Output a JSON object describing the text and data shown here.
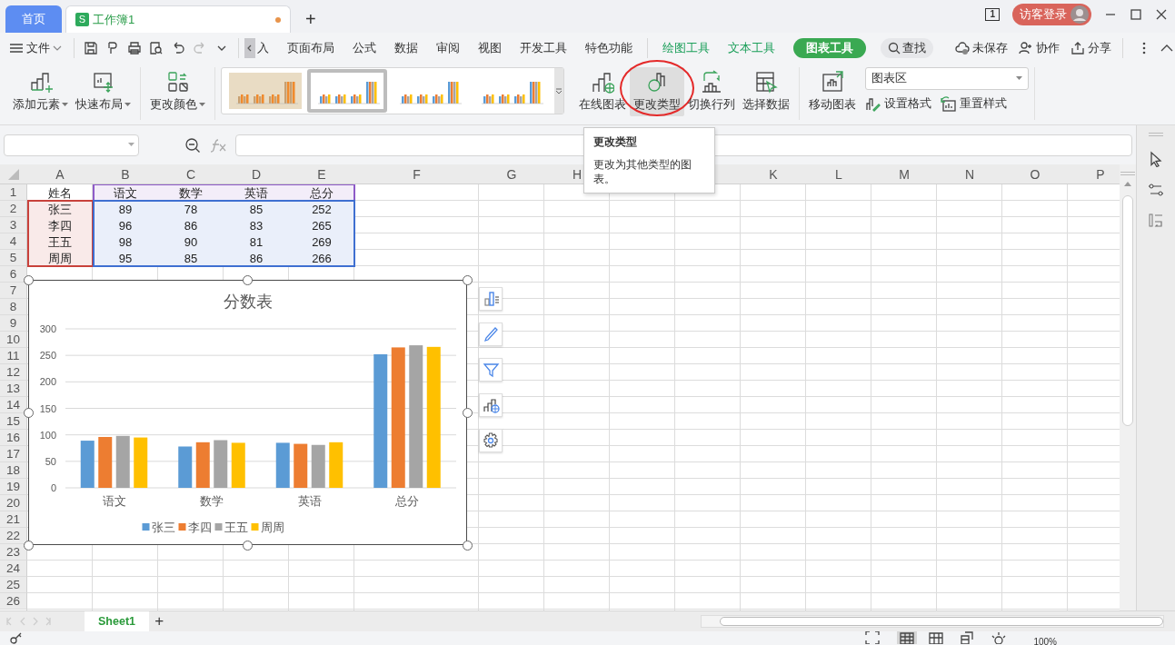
{
  "title_bar": {
    "tabs": [
      {
        "label": "首页",
        "kind": "home",
        "selected": false,
        "unsaved": false
      },
      {
        "label": "工作簿1",
        "kind": "doc",
        "badge": "S",
        "selected": true,
        "unsaved": true
      }
    ],
    "new_tab": "+",
    "page_count": "1",
    "login": "访客登录"
  },
  "menu": {
    "file": "文件",
    "tabs": [
      {
        "label": "入",
        "kind": "tab",
        "selected": false
      },
      {
        "label": "页面布局",
        "kind": "tab",
        "selected": false
      },
      {
        "label": "公式",
        "kind": "tab",
        "selected": false
      },
      {
        "label": "数据",
        "kind": "tab",
        "selected": false
      },
      {
        "label": "审阅",
        "kind": "tab",
        "selected": false
      },
      {
        "label": "视图",
        "kind": "tab",
        "selected": false
      },
      {
        "label": "开发工具",
        "kind": "tab",
        "selected": false
      },
      {
        "label": "特色功能",
        "kind": "tab",
        "selected": false
      },
      {
        "label": "绘图工具",
        "kind": "tool",
        "selected": false
      },
      {
        "label": "文本工具",
        "kind": "tool",
        "selected": false
      },
      {
        "label": "图表工具",
        "kind": "tool",
        "selected": true
      }
    ],
    "search": "查找",
    "actions": [
      "未保存",
      "协作",
      "分享"
    ]
  },
  "ribbon": {
    "groups": [
      {
        "kind": "buttons",
        "buttons": [
          {
            "label": "添加元素",
            "dropdown": true,
            "highlighted": false
          },
          {
            "label": "快速布局",
            "dropdown": true,
            "highlighted": false
          }
        ]
      },
      {
        "kind": "buttons",
        "buttons": [
          {
            "label": "更改颜色",
            "dropdown": true,
            "highlighted": false
          }
        ]
      },
      {
        "kind": "gallery",
        "styles": [
          {
            "selected": false
          },
          {
            "selected": true
          },
          {
            "selected": false
          },
          {
            "selected": false
          }
        ]
      },
      {
        "kind": "buttons",
        "buttons": [
          {
            "label": "在线图表",
            "dropdown": false,
            "highlighted": false
          },
          {
            "label": "更改类型",
            "dropdown": false,
            "highlighted": true
          },
          {
            "label": "切换行列",
            "dropdown": false,
            "highlighted": false
          },
          {
            "label": "选择数据",
            "dropdown": false,
            "highlighted": false
          }
        ]
      },
      {
        "kind": "buttons",
        "buttons": [
          {
            "label": "移动图表",
            "dropdown": false,
            "highlighted": false
          }
        ],
        "select": {
          "value": "图表区"
        },
        "small_buttons": [
          "设置格式",
          "重置样式"
        ]
      }
    ]
  },
  "tooltip": {
    "title": "更改类型",
    "text": "更改为其他类型的图表。"
  },
  "sheet": {
    "columns": [
      {
        "label": "A"
      },
      {
        "label": "B"
      },
      {
        "label": "C"
      },
      {
        "label": "D"
      },
      {
        "label": "E"
      },
      {
        "label": "F"
      },
      {
        "label": "G"
      },
      {
        "label": "H"
      },
      {},
      {},
      {
        "label": "K"
      },
      {
        "label": "L"
      },
      {
        "label": "M"
      },
      {
        "label": "N"
      },
      {
        "label": "O"
      },
      {
        "label": "P"
      }
    ],
    "rows": [
      "1",
      "2",
      "3",
      "4",
      "5",
      "6",
      "7",
      "8",
      "9",
      "10",
      "11",
      "12",
      "13",
      "14",
      "15",
      "16",
      "17",
      "18",
      "19",
      "20",
      "21",
      "22",
      "23",
      "24",
      "25",
      "26"
    ],
    "cells": [
      [
        "姓名",
        "语文",
        "数学",
        "英语",
        "总分"
      ],
      [
        "张三",
        "89",
        "78",
        "85",
        "252"
      ],
      [
        "李四",
        "96",
        "86",
        "83",
        "265"
      ],
      [
        "王五",
        "98",
        "90",
        "81",
        "269"
      ],
      [
        "周周",
        "95",
        "85",
        "86",
        "266"
      ]
    ],
    "ranges": [
      {
        "kind": "series_names",
        "color": "#8e5bc8"
      },
      {
        "kind": "categories",
        "color": "#c8413b"
      },
      {
        "kind": "values",
        "color": "#3f6fd1"
      }
    ]
  },
  "chart": {
    "selected": true,
    "chart_data": {
      "type": "bar",
      "title": "分数表",
      "categories": [
        "语文",
        "数学",
        "英语",
        "总分"
      ],
      "series": [
        {
          "name": "张三",
          "color": "#5b9bd5",
          "values": [
            89,
            78,
            85,
            252
          ]
        },
        {
          "name": "李四",
          "color": "#ed7d31",
          "values": [
            96,
            86,
            83,
            265
          ]
        },
        {
          "name": "王五",
          "color": "#a5a5a5",
          "values": [
            98,
            90,
            81,
            269
          ]
        },
        {
          "name": "周周",
          "color": "#ffc000",
          "values": [
            95,
            85,
            86,
            266
          ]
        }
      ],
      "ylim": [
        0,
        300
      ],
      "yticks": [
        0,
        50,
        100,
        150,
        200,
        250,
        300
      ],
      "grid": true,
      "legend": "bottom"
    }
  },
  "sheet_tabs": [
    {
      "label": "Sheet1",
      "selected": true
    }
  ],
  "add_sheet": "+",
  "status_bar": {
    "zoom": "100%"
  }
}
